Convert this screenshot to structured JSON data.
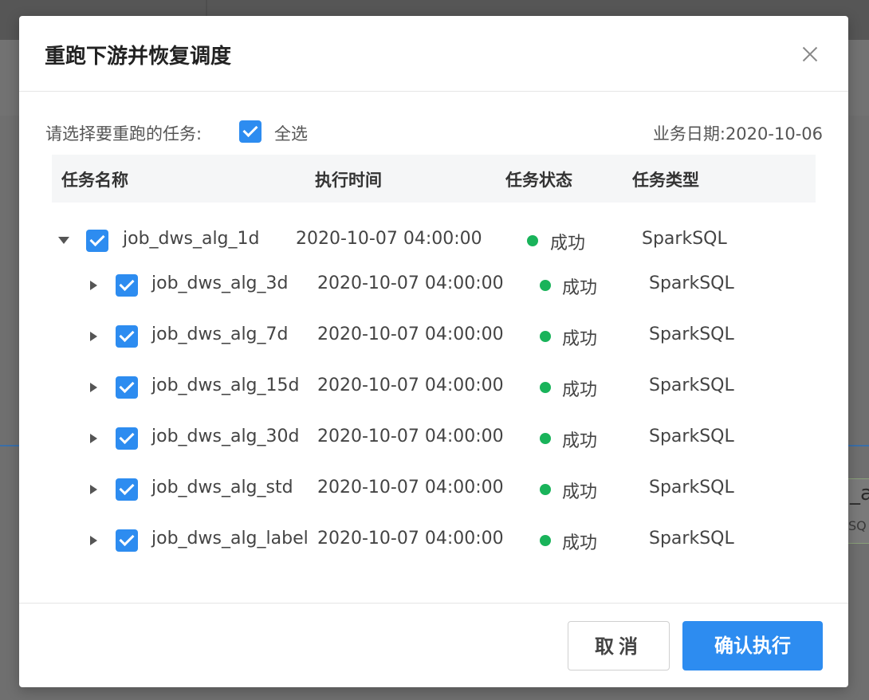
{
  "background": {
    "fragment_top": "_a",
    "fragment_bottom": "SQ"
  },
  "dialog": {
    "title": "重跑下游并恢复调度",
    "prompt": "请选择要重跑的任务:",
    "select_all_label": "全选",
    "select_all_checked": true,
    "business_date": "业务日期:2020-10-06",
    "columns": [
      "任务名称",
      "执行时间",
      "任务状态",
      "任务类型"
    ],
    "root_task": {
      "name": "job_dws_alg_1d",
      "time": "2020-10-07 04:00:00",
      "status": "成功",
      "type": "SparkSQL",
      "expanded": true,
      "checked": true
    },
    "child_tasks": [
      {
        "name": "job_dws_alg_3d",
        "time": "2020-10-07 04:00:00",
        "status": "成功",
        "type": "SparkSQL",
        "checked": true
      },
      {
        "name": "job_dws_alg_7d",
        "time": "2020-10-07 04:00:00",
        "status": "成功",
        "type": "SparkSQL",
        "checked": true
      },
      {
        "name": "job_dws_alg_15d",
        "time": "2020-10-07 04:00:00",
        "status": "成功",
        "type": "SparkSQL",
        "checked": true
      },
      {
        "name": "job_dws_alg_30d",
        "time": "2020-10-07 04:00:00",
        "status": "成功",
        "type": "SparkSQL",
        "checked": true
      },
      {
        "name": "job_dws_alg_std",
        "time": "2020-10-07 04:00:00",
        "status": "成功",
        "type": "SparkSQL",
        "checked": true
      },
      {
        "name": "job_dws_alg_label",
        "time": "2020-10-07 04:00:00",
        "status": "成功",
        "type": "SparkSQL",
        "checked": true
      }
    ],
    "buttons": {
      "cancel": "取消",
      "confirm": "确认执行"
    },
    "colors": {
      "accent": "#2d8cf0",
      "success_dot": "#19b35a"
    }
  }
}
